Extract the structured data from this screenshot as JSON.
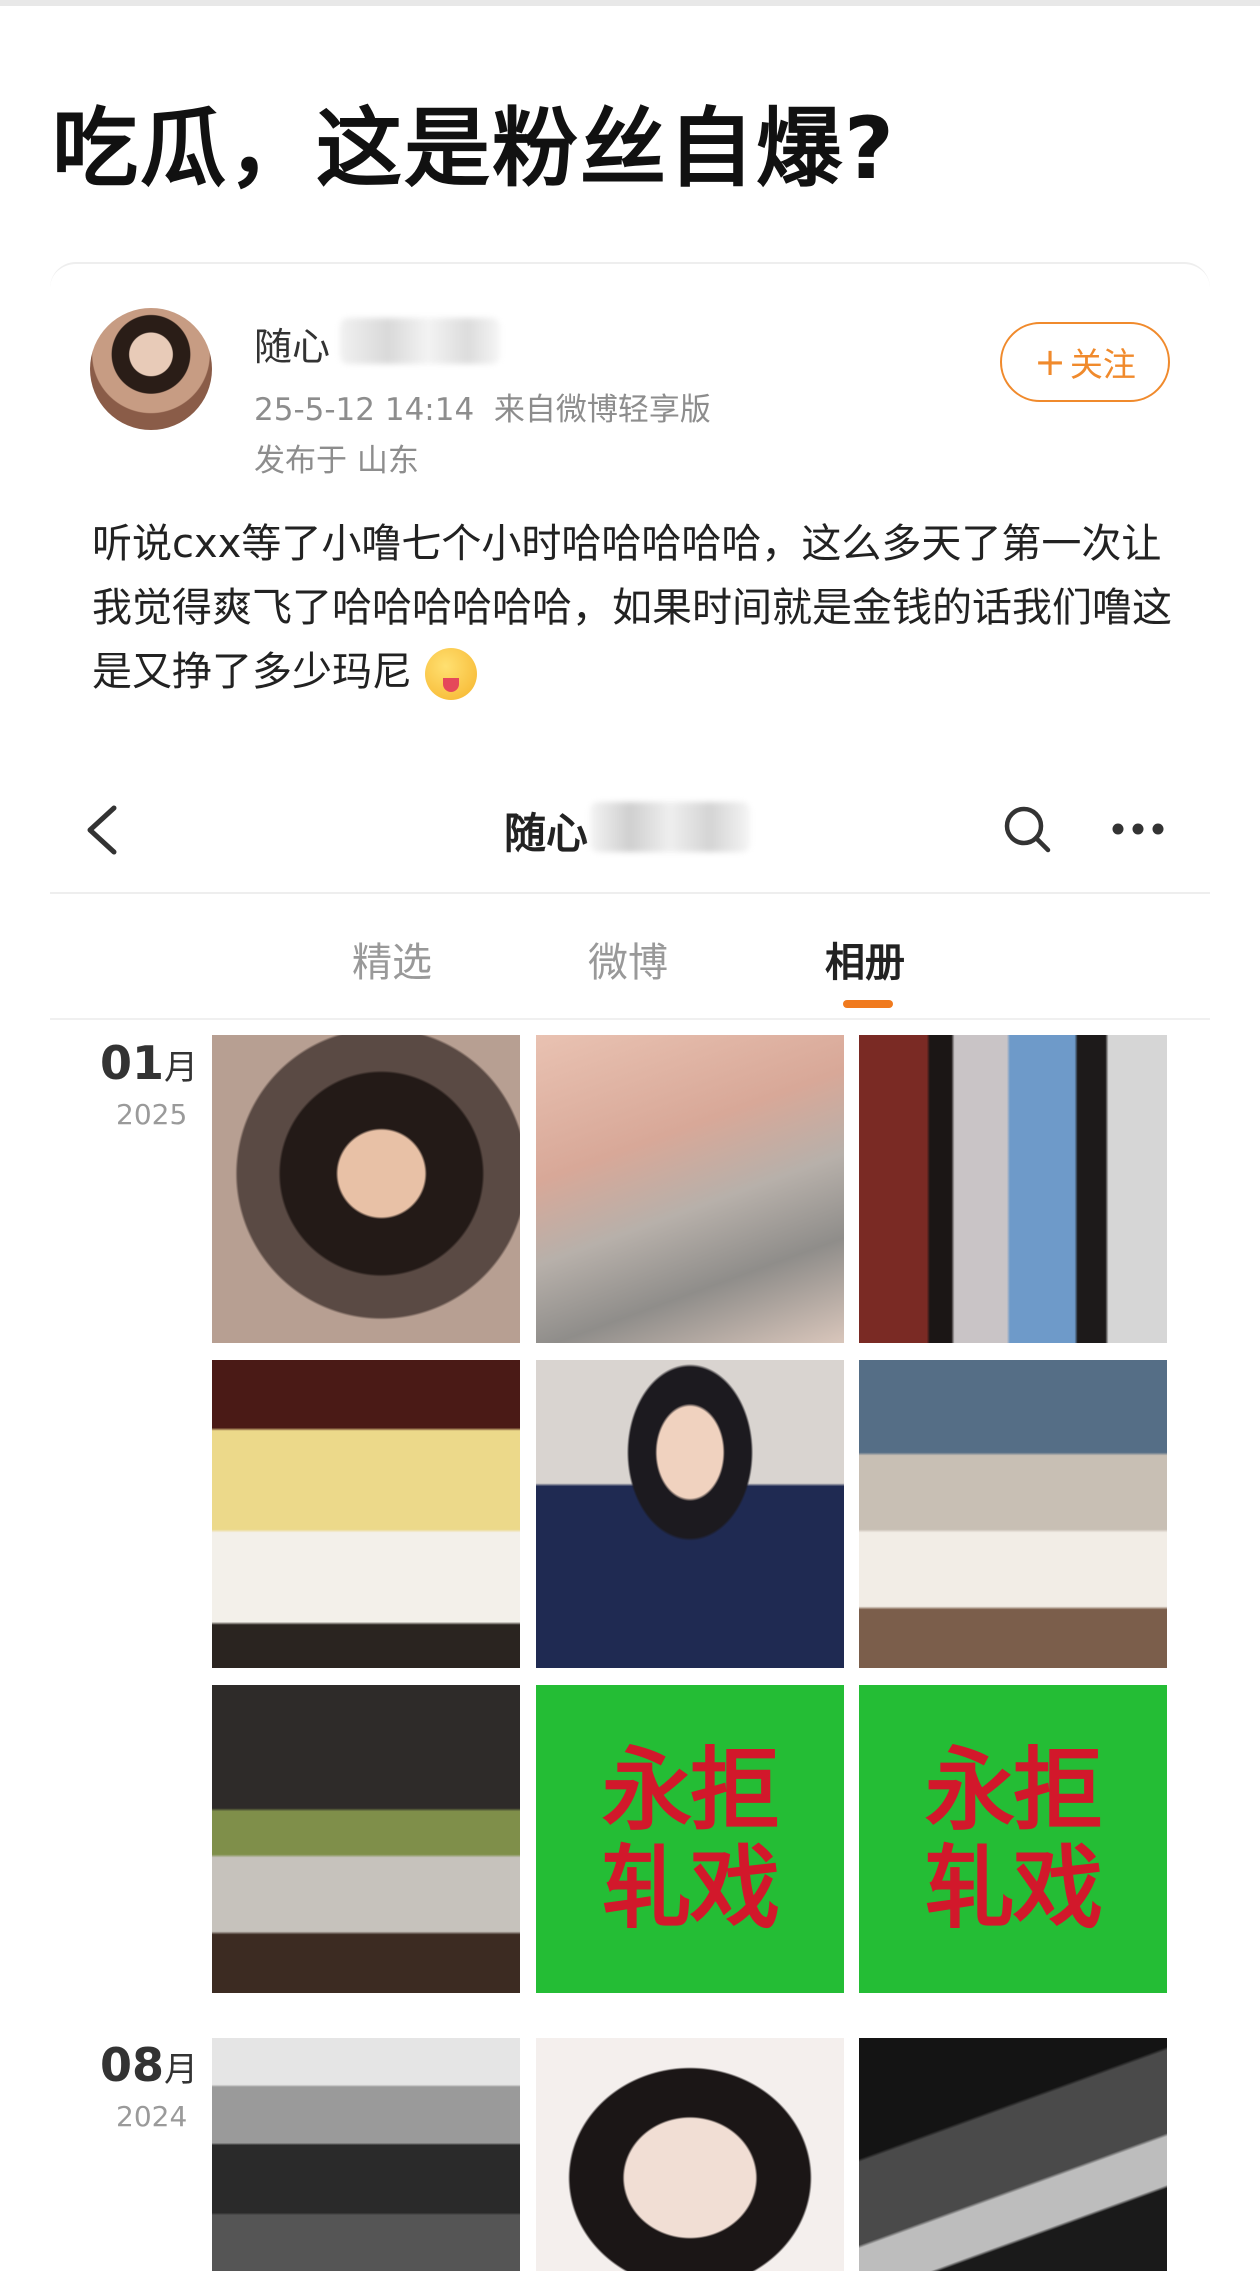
{
  "headline": "吃瓜，这是粉丝自爆?",
  "post": {
    "username_visible": "随心",
    "time": "25-5-12 14:14",
    "source": "来自微博轻享版",
    "location": "发布于 山东",
    "follow_label": "关注",
    "text": "听说cxx等了小噜七个小时哈哈哈哈哈，这么多天了第一次让我觉得爽飞了哈哈哈哈哈哈，如果时间就是金钱的话我们噜这是又挣了多少玛尼",
    "emoji": "tongue-emoji"
  },
  "profile_nav": {
    "back_icon": "chevron-left-icon",
    "title_visible": "随心",
    "search_icon": "search-icon",
    "more_icon": "more-dots-icon"
  },
  "tabs": [
    {
      "label": "精选",
      "active": false
    },
    {
      "label": "微博",
      "active": false
    },
    {
      "label": "相册",
      "active": true
    }
  ],
  "album": {
    "groups": [
      {
        "month": "01",
        "month_unit": "月",
        "year": "2025"
      },
      {
        "month": "08",
        "month_unit": "月",
        "year": "2024"
      }
    ],
    "ban_text_line1": "永拒",
    "ban_text_line2": "轧戏"
  },
  "colors": {
    "accent": "#f08a2c",
    "tab_indicator": "#f07a1e",
    "ban_bg": "#24bd35",
    "ban_text": "#d2182b"
  }
}
